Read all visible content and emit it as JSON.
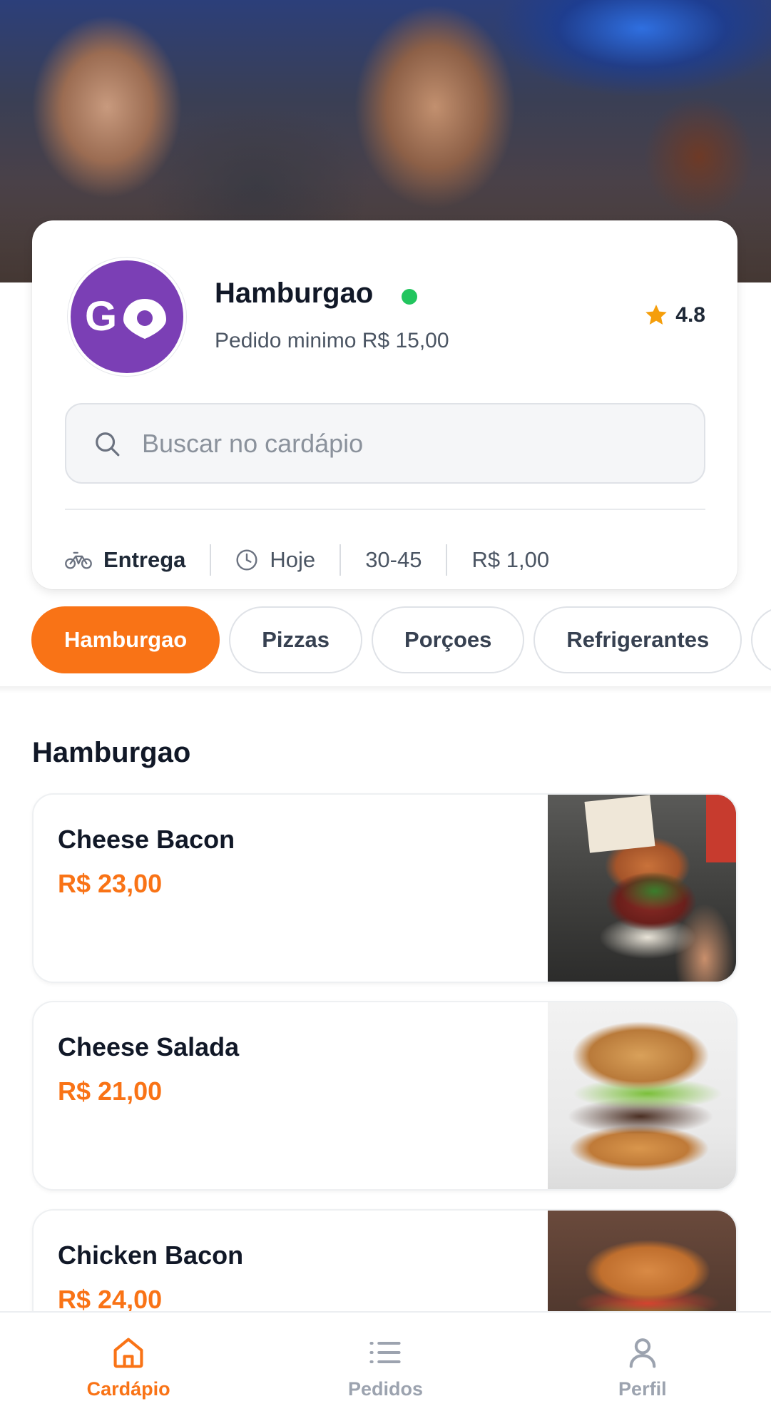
{
  "store": {
    "name": "Hamburgao",
    "logo_text": "GO",
    "status": "online",
    "min_order": "Pedido minimo R$ 15,00",
    "rating": "4.8"
  },
  "search": {
    "placeholder": "Buscar no cardápio"
  },
  "delivery_info": {
    "mode": "Entrega",
    "day": "Hoje",
    "time": "30-45",
    "fee": "R$ 1,00"
  },
  "categories": [
    {
      "label": "Hamburgao",
      "active": true
    },
    {
      "label": "Pizzas",
      "active": false
    },
    {
      "label": "Porçoes",
      "active": false
    },
    {
      "label": "Refrigerantes",
      "active": false
    }
  ],
  "section": {
    "title": "Hamburgao"
  },
  "products": [
    {
      "name": "Cheese Bacon",
      "price": "R$ 23,00"
    },
    {
      "name": "Cheese Salada",
      "price": "R$ 21,00"
    },
    {
      "name": "Chicken Bacon",
      "price": "R$ 24,00"
    }
  ],
  "bottom_nav": [
    {
      "label": "Cardápio",
      "icon": "home-icon",
      "active": true
    },
    {
      "label": "Pedidos",
      "icon": "list-icon",
      "active": false
    },
    {
      "label": "Perfil",
      "icon": "user-icon",
      "active": false
    }
  ],
  "colors": {
    "accent": "#f97316",
    "logo_background": "#7b3fb5",
    "online": "#22c55e",
    "star": "#f59e0b"
  }
}
